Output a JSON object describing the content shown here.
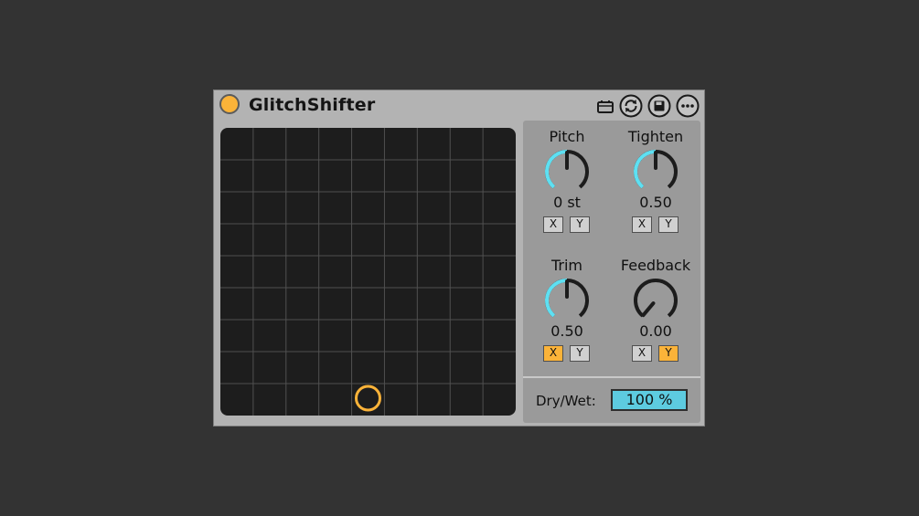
{
  "device": {
    "title": "GlitchShifter",
    "accent_color": "#fbb339",
    "knob_arc_color": "#5ee0f2",
    "header_icons": [
      "clip-icon",
      "hotswap-icon",
      "save-icon",
      "more-icon"
    ]
  },
  "xy_pad": {
    "grid_cols": 9,
    "grid_rows": 9,
    "puck_x": 0.5,
    "puck_y": 0.03
  },
  "knobs": [
    {
      "label": "Pitch",
      "value_text": "0 st",
      "level": 0.5,
      "x_on": false,
      "y_on": false
    },
    {
      "label": "Tighten",
      "value_text": "0.50",
      "level": 0.5,
      "x_on": false,
      "y_on": false
    },
    {
      "label": "Trim",
      "value_text": "0.50",
      "level": 0.5,
      "x_on": true,
      "y_on": false
    },
    {
      "label": "Feedback",
      "value_text": "0.00",
      "level": 0.0,
      "x_on": false,
      "y_on": true
    }
  ],
  "toggle_labels": {
    "x": "X",
    "y": "Y"
  },
  "dry_wet": {
    "label": "Dry/Wet:",
    "value": "100 %"
  }
}
